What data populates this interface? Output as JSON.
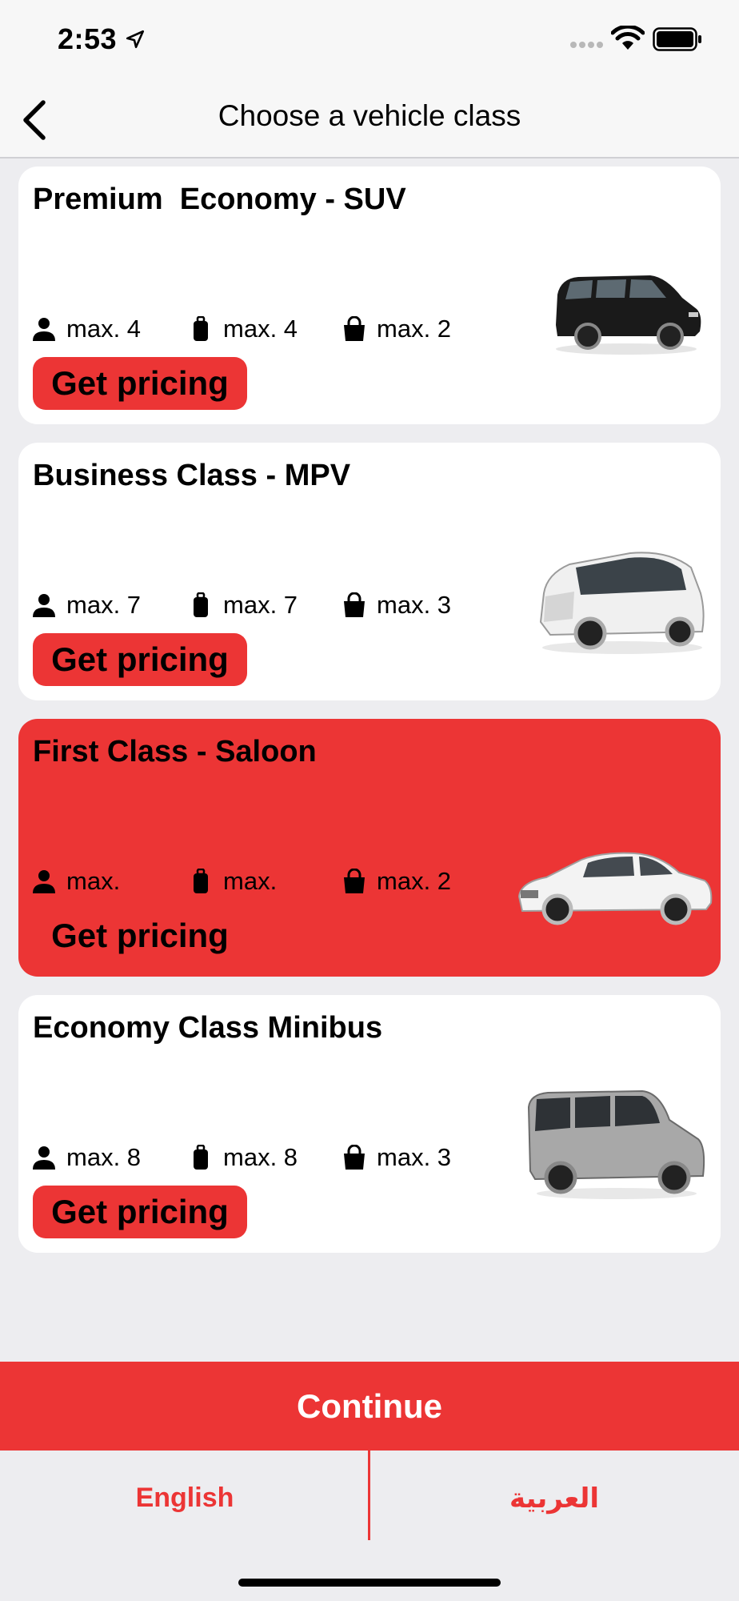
{
  "status_bar": {
    "time": "2:53"
  },
  "header": {
    "title": "Choose a vehicle class"
  },
  "vehicles": [
    {
      "title": "Premium  Economy - SUV",
      "passengers": "max. 4",
      "luggage": "max. 4",
      "bags": "max. 2",
      "button": "Get pricing",
      "car_color": "#1a1a1a",
      "selected": false
    },
    {
      "title": "Business Class - MPV",
      "passengers": "max. 7",
      "luggage": "max. 7",
      "bags": "max. 3",
      "button": "Get pricing",
      "car_color": "#eeeeee",
      "selected": false
    },
    {
      "title": "First Class - Saloon",
      "passengers": "max.",
      "luggage": "max.",
      "bags": "max. 2",
      "button": "Get pricing",
      "car_color": "#f2f2f2",
      "selected": true
    },
    {
      "title": "Economy Class Minibus",
      "passengers": "max. 8",
      "luggage": "max. 8",
      "bags": "max. 3",
      "button": "Get pricing",
      "car_color": "#a8a8a8",
      "selected": false
    }
  ],
  "footer": {
    "continue_label": "Continue",
    "lang_en": "English",
    "lang_ar": "العربية"
  },
  "colors": {
    "accent": "#ec3535",
    "background": "#ededf0",
    "card": "#ffffff"
  }
}
